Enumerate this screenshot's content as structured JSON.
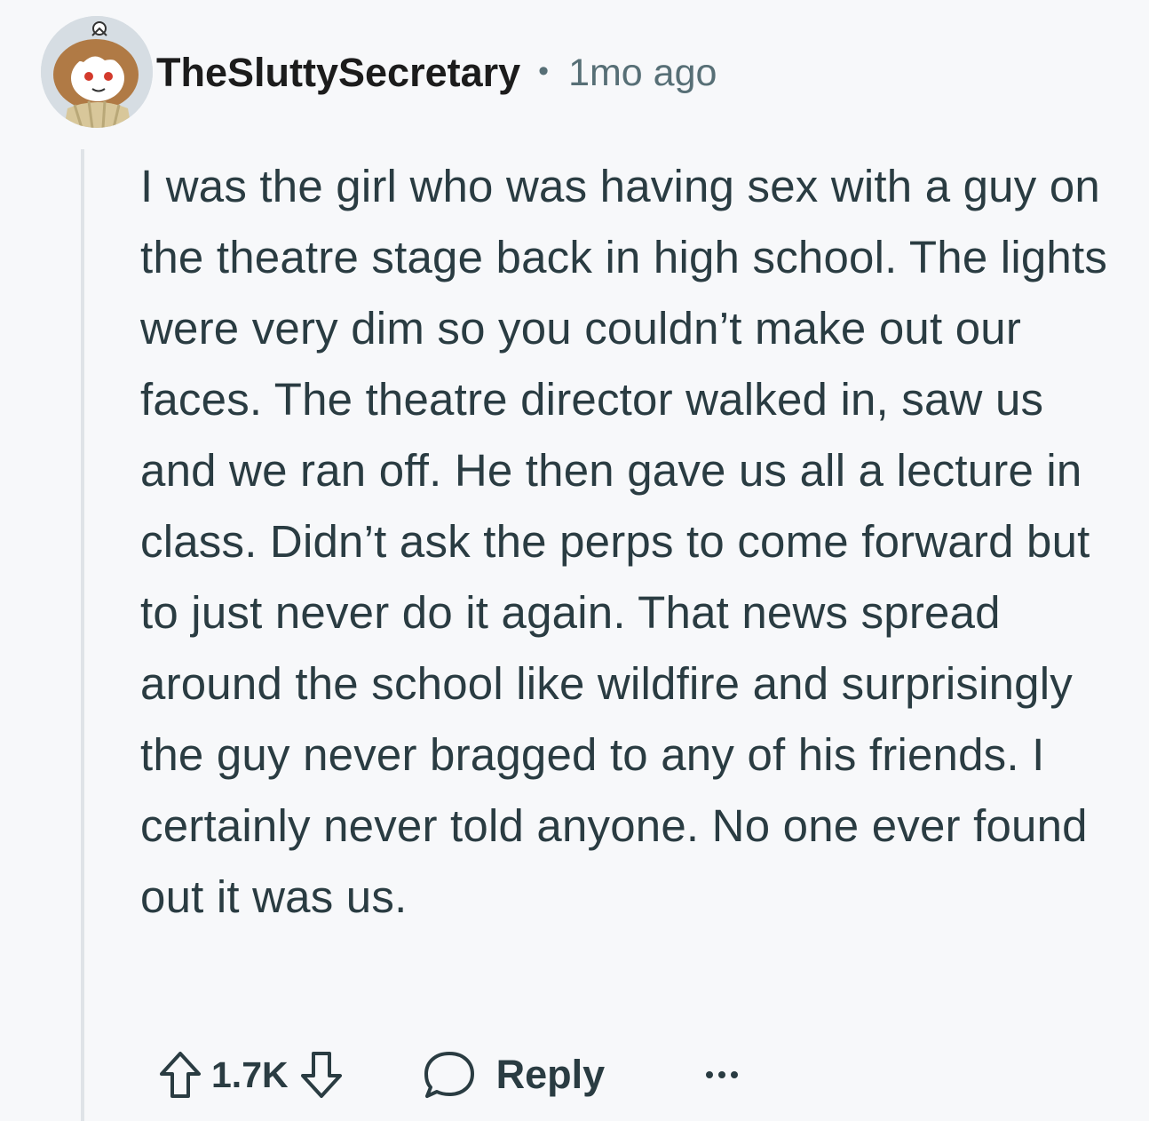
{
  "comment": {
    "author": "TheSluttySecretary",
    "separator": "•",
    "timestamp": "1mo ago",
    "body": "I was the girl who was having sex with a guy on the theatre stage back in high school. The lights were very dim so you couldn’t make out our faces. The theatre director walked in, saw us and we ran off. He then gave us all a lecture in class. Didn’t ask the perps to come forward but to just never do it again. That news spread around the school like wildfire and surprisingly the guy never bragged to any of his friends. I certainly never told anyone. No one ever found out it was us.",
    "vote_count": "1.7K",
    "reply_label": "Reply"
  },
  "icons": {
    "avatar": "snoo-avatar-icon",
    "upvote": "upvote-arrow-icon",
    "downvote": "downvote-arrow-icon",
    "reply": "speech-bubble-icon",
    "more": "more-options-icon"
  },
  "colors": {
    "background": "#f7f8fa",
    "text_primary": "#1c1c1c",
    "text_secondary": "#576f76",
    "body_text": "#2a3c42",
    "thread_line": "#dfe3e7"
  }
}
